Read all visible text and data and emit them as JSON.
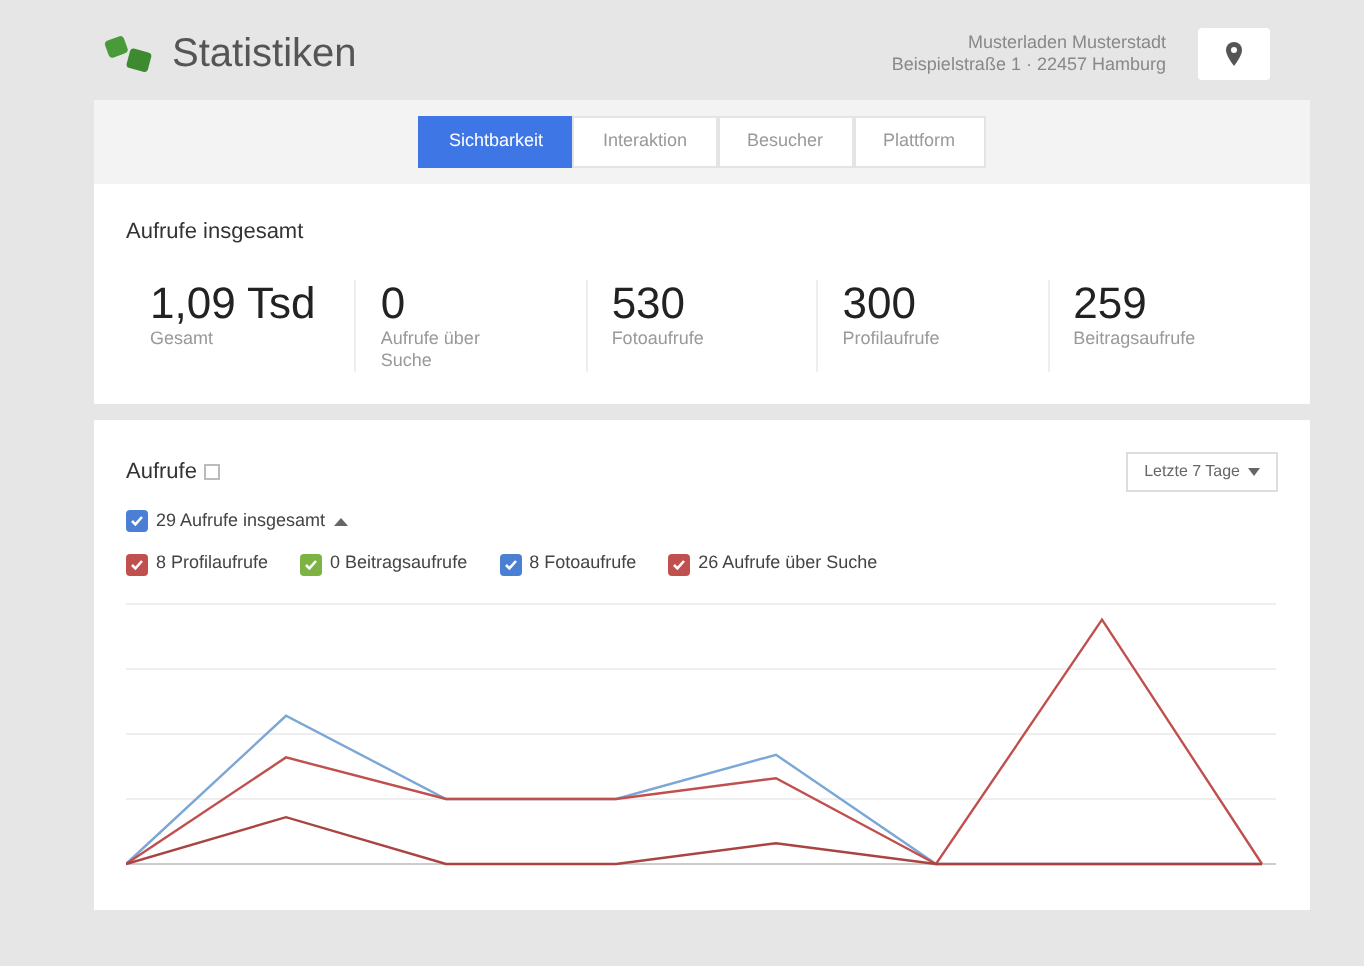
{
  "header": {
    "title": "Statistiken",
    "business_name": "Musterladen Musterstadt",
    "address": "Beispielstraße 1 · 22457 Hamburg"
  },
  "tabs": [
    {
      "label": "Sichtbarkeit",
      "selected": true
    },
    {
      "label": "Interaktion",
      "selected": false
    },
    {
      "label": "Besucher",
      "selected": false
    },
    {
      "label": "Plattform",
      "selected": false
    }
  ],
  "totals": {
    "title": "Aufrufe insgesamt",
    "stats": [
      {
        "value": "1,09 Tsd",
        "label": "Gesamt"
      },
      {
        "value": "0",
        "label": "Aufrufe über Suche"
      },
      {
        "value": "530",
        "label": "Fotoaufrufe"
      },
      {
        "value": "300",
        "label": "Profilaufrufe"
      },
      {
        "value": "259",
        "label": "Beitragsaufrufe"
      }
    ]
  },
  "views": {
    "title": "Aufrufe",
    "range": "Letzte 7 Tage",
    "total": {
      "label": "29 Aufrufe insgesamt",
      "checked": true,
      "color": "#4a7fd4"
    },
    "series": [
      {
        "label": "8 Profilaufrufe",
        "checked": true,
        "color": "#c0504d"
      },
      {
        "label": "0 Beitragsaufrufe",
        "checked": true,
        "color": "#7cb342"
      },
      {
        "label": "8 Fotoaufrufe",
        "checked": true,
        "color": "#4a7fd4"
      },
      {
        "label": "26 Aufrufe über Suche",
        "checked": true,
        "color": "#c0504d"
      }
    ]
  }
}
